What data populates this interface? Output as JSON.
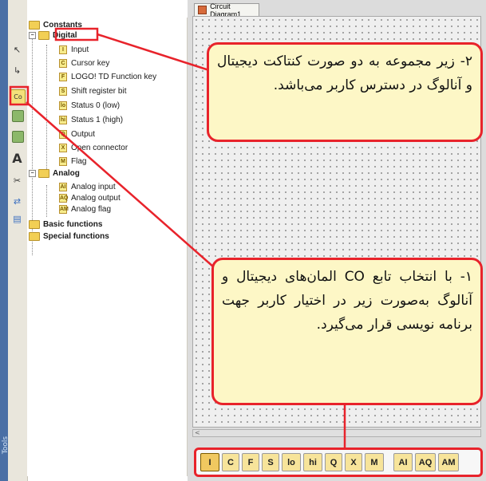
{
  "window": {
    "tab_title": "Circuit Diagram1",
    "strip_label": "Tools"
  },
  "toolbar": {
    "tools": [
      {
        "name": "pointer-icon",
        "glyph": "↖"
      },
      {
        "name": "connect-icon",
        "glyph": "↳"
      },
      {
        "name": "constants-icon",
        "glyph": "Co",
        "active": true
      },
      {
        "name": "basic-functions-icon",
        "glyph": "≣"
      },
      {
        "name": "special-functions-icon",
        "glyph": "≣"
      },
      {
        "name": "text-icon",
        "glyph": "A"
      },
      {
        "name": "cut-icon",
        "glyph": "✂"
      },
      {
        "name": "wire-icon",
        "glyph": "⇄"
      },
      {
        "name": "block-icon",
        "glyph": "▤"
      }
    ]
  },
  "tree": {
    "root": "Constants",
    "digital": "Digital",
    "digital_items": [
      {
        "icon": "I",
        "label": "Input"
      },
      {
        "icon": "C",
        "label": "Cursor key"
      },
      {
        "icon": "F",
        "label": "LOGO! TD Function key"
      },
      {
        "icon": "S",
        "label": "Shift register bit"
      },
      {
        "icon": "lo",
        "label": "Status 0 (low)"
      },
      {
        "icon": "hi",
        "label": "Status 1 (high)"
      },
      {
        "icon": "Q",
        "label": "Output"
      },
      {
        "icon": "X",
        "label": "Open connector"
      },
      {
        "icon": "M",
        "label": "Flag"
      }
    ],
    "analog": "Analog",
    "analog_items": [
      {
        "icon": "AI",
        "label": "Analog input"
      },
      {
        "icon": "AQ",
        "label": "Analog output"
      },
      {
        "icon": "AM",
        "label": "Analog flag"
      }
    ],
    "basic": "Basic functions",
    "special": "Special functions"
  },
  "palette": {
    "buttons": [
      "I",
      "C",
      "F",
      "S",
      "lo",
      "hi",
      "Q",
      "X",
      "M",
      "AI",
      "AQ",
      "AM"
    ],
    "active": "I"
  },
  "callouts": {
    "top": "۲- زیر مجموعه به دو صورت کنتاکت دیجیتال و آنالوگ در دسترس کاربر می‌باشد.",
    "bottom": "۱- با انتخاب تابع CO المان‌های دیجیتال و آنالوگ به‌صورت زیر در اختیار کاربر جهت برنامه نویسی قرار می‌گیرد."
  },
  "colors": {
    "callout_border": "#e8232b",
    "callout_fill": "#fdf7c6",
    "folder": "#f2cf55"
  }
}
